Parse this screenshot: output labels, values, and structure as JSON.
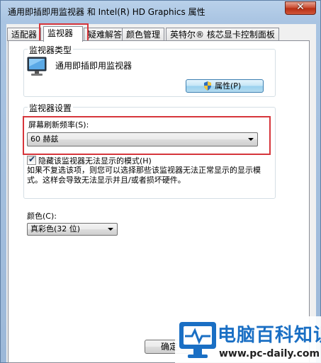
{
  "window": {
    "title": "通用即插即用监视器 和 Intel(R) HD Graphics 属性",
    "close_label": "✕"
  },
  "tabs": [
    {
      "label": "适配器"
    },
    {
      "label": "监视器"
    },
    {
      "label": "疑难解答"
    },
    {
      "label": "颜色管理"
    },
    {
      "label": "英特尔® 核芯显卡控制面板"
    }
  ],
  "monitor_type": {
    "group_title": "监视器类型",
    "monitor_name": "通用即插即用监视器",
    "properties_button": "属性(P)"
  },
  "monitor_settings": {
    "group_title": "监视器设置",
    "refresh_label": "屏幕刷新频率(S):",
    "refresh_value": "60 赫兹",
    "hide_modes_label": "隐藏该监视器无法显示的模式(H)",
    "hide_modes_checked": true,
    "description": "如果不复选该项，则您可以选择那些该监视器无法正常显示的显示模式。这样会导致无法显示并且/或者损坏硬件。"
  },
  "colors": {
    "label": "颜色(C):",
    "value": "真彩色(32 位)"
  },
  "footer": {
    "ok_label": "确定"
  },
  "watermark": {
    "title": "电脑百科知识",
    "url": "www.pc-daily.com"
  },
  "accent_colors": {
    "highlight": "#d6353b",
    "watermark_blue": "#1a6fc4"
  }
}
